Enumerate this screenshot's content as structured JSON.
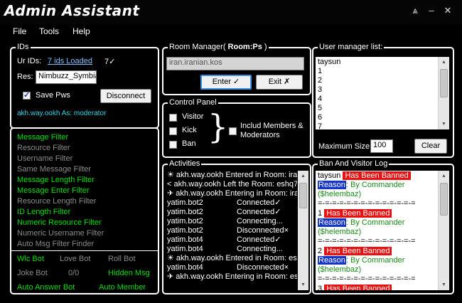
{
  "app": {
    "title": "Admin Assistant"
  },
  "menu": [
    "File",
    "Tools",
    "Help"
  ],
  "ids": {
    "title": "IDs",
    "ur_ids_label": "Ur IDs:",
    "ids_loaded": "7 ids Loaded",
    "ids_count": "7✓",
    "res_label": "Res:",
    "res_value": "Nimbuzz_Symbia",
    "save_pws": "Save Pws",
    "disconnect": "Disconnect",
    "status": "akh.way.ookh As: moderator"
  },
  "filters": [
    {
      "label": "Message Filter",
      "on": true
    },
    {
      "label": "Resource Filter",
      "on": false
    },
    {
      "label": "Username Filter",
      "on": false
    },
    {
      "label": "Same Message Filter",
      "on": false
    },
    {
      "label": "Message Length Filter",
      "on": true
    },
    {
      "label": "Message Enter Filter",
      "on": true
    },
    {
      "label": "Resource Length Filter",
      "on": false
    },
    {
      "label": "ID Length Filter",
      "on": true
    },
    {
      "label": "Numeric Resource Filter",
      "on": true
    },
    {
      "label": "Numeric Username Filter",
      "on": false
    },
    {
      "label": "Auto Msg Filter Finder",
      "on": false
    }
  ],
  "bots": {
    "wlc": "Wlc Bot",
    "love": "Love Bot",
    "roll": "Roll Bot",
    "joke": "Joke Bot",
    "joke_count": "0/0",
    "hidden": "Hidden Msg",
    "auto_answer": "Auto Answer Bot",
    "auto_member": "Auto Member"
  },
  "room_manager": {
    "title_prefix": "Room Manager(",
    "title_room": "Room:Ps",
    "title_suffix": ")",
    "room_value": "iran.iranian.kos",
    "enter": "Enter ✓",
    "exit": "Exit  ✗"
  },
  "control_panel": {
    "title": "Control Panel",
    "visitor": "Visitor",
    "kick": "Kick",
    "ban": "Ban",
    "brace": "}",
    "include": "Includ Members & Moderators"
  },
  "user_manager": {
    "title": "User manager list:",
    "users": [
      "taysun",
      "1",
      "2",
      "3",
      "4",
      "5",
      "6",
      "7"
    ],
    "max_size_label": "Maximum Size:",
    "max_size_value": "100",
    "clear": "Clear"
  },
  "activities": {
    "title": "Activities",
    "rows": [
      {
        "name": "☀ akh.way.ookh Entered in Room: ira",
        "status": ""
      },
      {
        "name": "< akh.way.ookh Left the Room: eshq7",
        "status": ""
      },
      {
        "name": "✈ akh.way.ookh Entering in Room: ira",
        "status": ""
      },
      {
        "name": "yatim.bot2",
        "status": "Connected✓"
      },
      {
        "name": "yatim.bot2",
        "status": "Connected✓"
      },
      {
        "name": "yatim.bot2",
        "status": "Connecting..."
      },
      {
        "name": "yatim.bot2",
        "status": "Disconnected×"
      },
      {
        "name": "yatim.bot4",
        "status": "Connected✓"
      },
      {
        "name": "yatim.bot4",
        "status": "Connecting..."
      },
      {
        "name": "☀ akh.way.ookh Entered in Room: es",
        "status": ""
      },
      {
        "name": "yatim.bot4",
        "status": "Disconnected×"
      },
      {
        "name": "✈ akh.way.ookh Entering in Room: es",
        "status": ""
      }
    ]
  },
  "ban_log": {
    "title": "Ban And Visitor Log",
    "has_been_banned": "Has Been Banned",
    "reason": "Reason",
    "by_commander": ": By Commander",
    "commander": "($helembaz)",
    "separator": "=-=-=-=-=-=-=-=-=-=-=-=-=-=",
    "entries": [
      "taysun",
      "1",
      "2",
      "3"
    ]
  }
}
